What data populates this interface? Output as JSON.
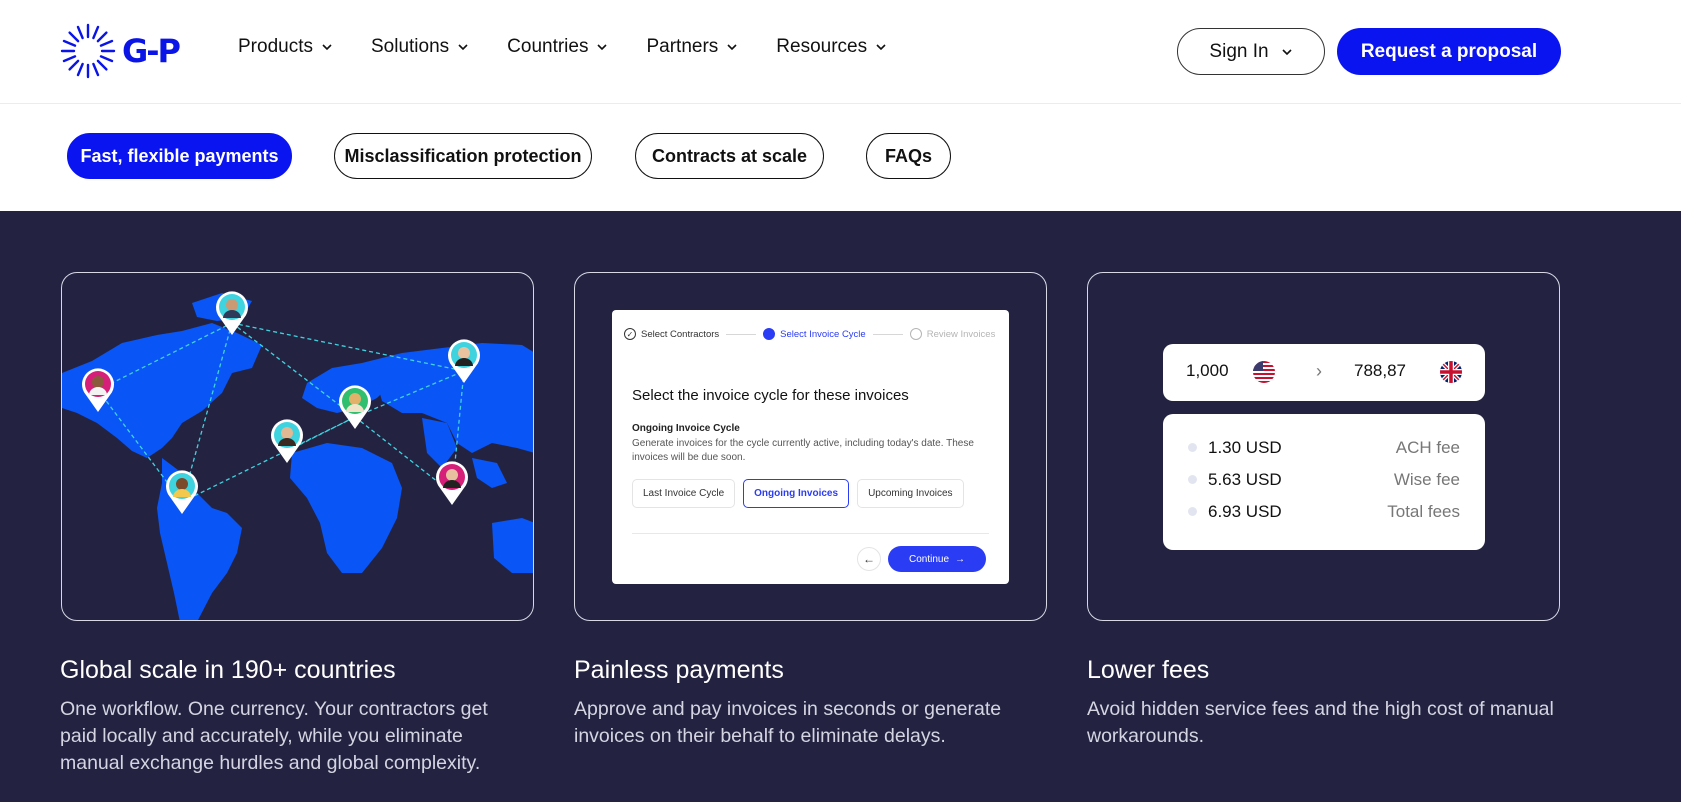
{
  "header": {
    "logo_text": "G-P",
    "nav": [
      "Products",
      "Solutions",
      "Countries",
      "Partners",
      "Resources"
    ],
    "sign_in": "Sign In",
    "request": "Request a proposal"
  },
  "tabs": [
    "Fast, flexible payments",
    "Misclassification protection",
    "Contracts at scale",
    "FAQs"
  ],
  "cards": [
    {
      "title": "Global scale in 190+ countries",
      "desc": "One workflow. One currency. Your contractors get paid locally and accurately, while you eliminate manual exchange hurdles and global complexity."
    },
    {
      "title": "Painless payments",
      "desc": "Approve and pay invoices in seconds or generate invoices on their behalf to eliminate delays."
    },
    {
      "title": "Lower fees",
      "desc": "Avoid hidden service fees and the high cost of manual workarounds."
    }
  ],
  "invoice": {
    "steps": [
      "Select Contractors",
      "Select Invoice Cycle",
      "Review Invoices"
    ],
    "title": "Select the invoice cycle for these invoices",
    "subtitle": "Ongoing Invoice Cycle",
    "desc": "Generate invoices for the cycle currently active, including today's date. These invoices will be due soon.",
    "options": [
      "Last Invoice Cycle",
      "Ongoing Invoices",
      "Upcoming Invoices"
    ],
    "continue": "Continue"
  },
  "fees": {
    "from_amount": "1,000",
    "to_amount": "788,87",
    "rows": [
      {
        "amount": "1.30 USD",
        "label": "ACH fee"
      },
      {
        "amount": "5.63 USD",
        "label": "Wise fee"
      },
      {
        "amount": "6.93 USD",
        "label": "Total fees"
      }
    ]
  },
  "colors": {
    "brand_blue": "#0a14f0",
    "dark_bg": "#232341",
    "map_blue": "#0a55f5",
    "connector": "#3fd3e0"
  }
}
